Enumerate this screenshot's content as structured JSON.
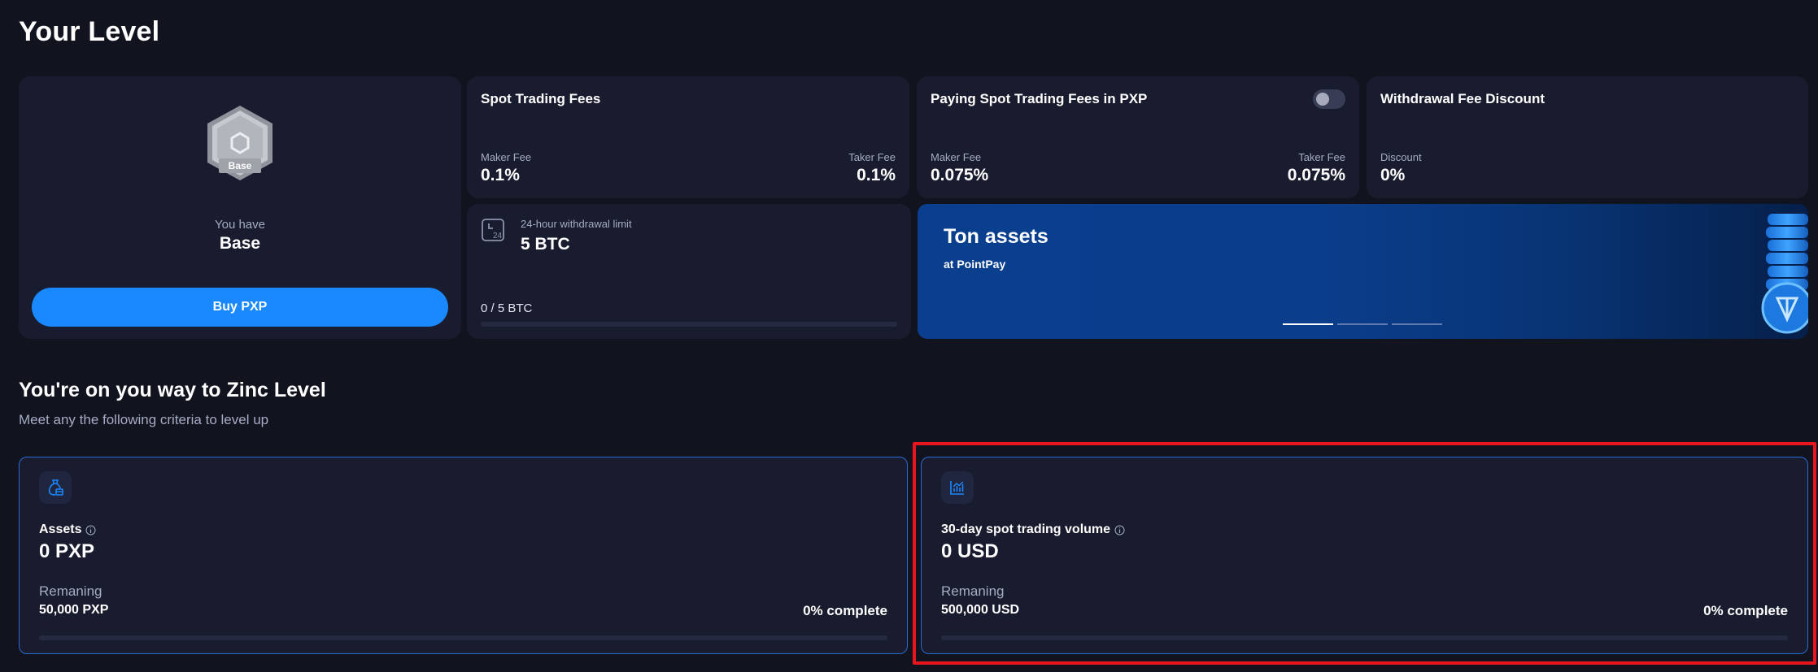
{
  "page": {
    "title": "Your Level"
  },
  "level": {
    "you_have_label": "You have",
    "name": "Base",
    "badge_text": "Base",
    "buy_button": "Buy PXP"
  },
  "spot_fees": {
    "title": "Spot Trading Fees",
    "maker_label": "Maker Fee",
    "maker_value": "0.1%",
    "taker_label": "Taker Fee",
    "taker_value": "0.1%"
  },
  "pxp_fees": {
    "title": "Paying Spot Trading Fees in PXP",
    "toggle_on": false,
    "maker_label": "Maker Fee",
    "maker_value": "0.075%",
    "taker_label": "Taker Fee",
    "taker_value": "0.075%"
  },
  "withdrawal_discount": {
    "title": "Withdrawal Fee Discount",
    "discount_label": "Discount",
    "discount_value": "0%"
  },
  "withdrawal_limit": {
    "label": "24-hour withdrawal limit",
    "value": "5 BTC",
    "progress_text": "0 / 5 BTC",
    "progress_fraction": 0
  },
  "banner": {
    "title": "Ton assets",
    "subtitle": "at PointPay",
    "slide_count": 3,
    "active_slide": 0
  },
  "next_level": {
    "title": "You're on you way to Zinc Level",
    "subtitle": "Meet any the following criteria to level up"
  },
  "criteria": [
    {
      "icon": "money-bag-icon",
      "label": "Assets",
      "value": "0 PXP",
      "remaining_label": "Remaning",
      "remaining_value": "50,000 PXP",
      "complete_text": "0% complete",
      "progress_fraction": 0
    },
    {
      "icon": "chart-icon",
      "label": "30-day spot trading volume",
      "value": "0 USD",
      "remaining_label": "Remaning",
      "remaining_value": "500,000 USD",
      "complete_text": "0% complete",
      "progress_fraction": 0
    }
  ],
  "colors": {
    "background": "#11131f",
    "card": "#191c2e",
    "accent": "#1a89ff",
    "highlight": "#e8141e"
  }
}
